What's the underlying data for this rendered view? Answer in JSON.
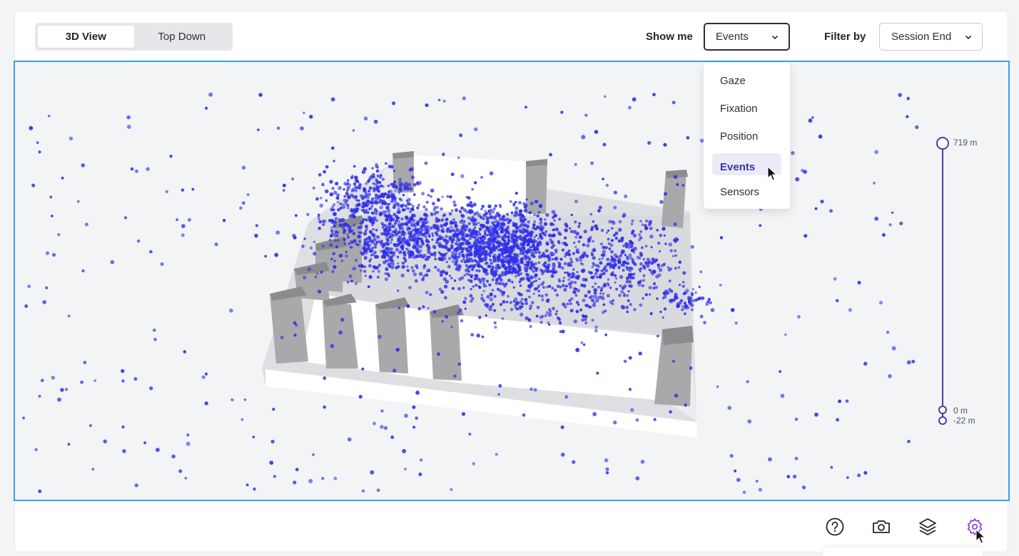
{
  "view_toggle": {
    "options": [
      "3D View",
      "Top Down"
    ],
    "active": "3D View"
  },
  "show_me": {
    "label": "Show me",
    "value": "Events"
  },
  "filter_by": {
    "label": "Filter by",
    "value": "Session End"
  },
  "dropdown": {
    "options": [
      "Gaze",
      "Fixation",
      "Position",
      "Events",
      "Sensors"
    ],
    "selected": "Events"
  },
  "altitude": {
    "top": "719 m",
    "mid": "0 m",
    "bottom": "-22 m"
  },
  "toolbar": {
    "icons": [
      "help-icon",
      "camera-icon",
      "layers-icon",
      "settings-icon"
    ],
    "accent": "#7c3aed"
  },
  "colors": {
    "viewport_border": "#3aa0e6",
    "points": "#2f2fe8",
    "slider": "#4a3ea6"
  }
}
